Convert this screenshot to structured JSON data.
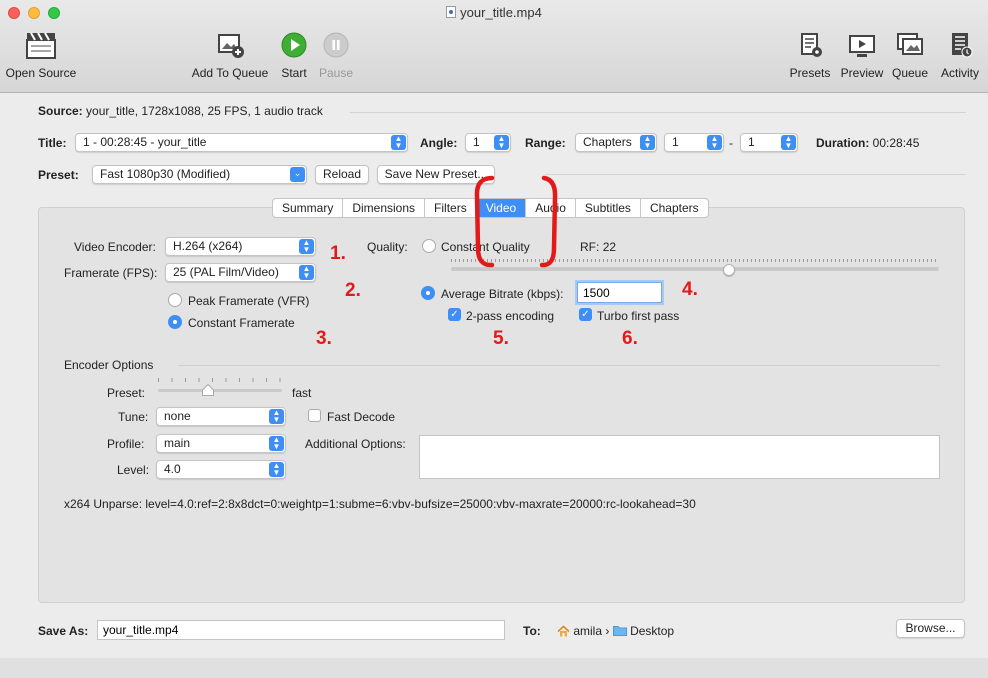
{
  "window": {
    "title": "your_title.mp4"
  },
  "toolbar": {
    "open_source": "Open Source",
    "add_to_queue": "Add To Queue",
    "start": "Start",
    "pause": "Pause",
    "presets": "Presets",
    "preview": "Preview",
    "queue": "Queue",
    "activity": "Activity"
  },
  "source": {
    "label": "Source:",
    "value": "your_title, 1728x1088, 25 FPS, 1 audio track"
  },
  "title_row": {
    "title_label": "Title:",
    "title_value": "1 - 00:28:45 - your_title",
    "angle_label": "Angle:",
    "angle_value": "1",
    "range_label": "Range:",
    "range_type": "Chapters",
    "range_start": "1",
    "range_dash": "-",
    "range_end": "1",
    "duration_label": "Duration:",
    "duration_value": "00:28:45"
  },
  "preset_row": {
    "label": "Preset:",
    "value": "Fast 1080p30 (Modified)",
    "reload": "Reload",
    "save_new": "Save New Preset..."
  },
  "tabs": [
    "Summary",
    "Dimensions",
    "Filters",
    "Video",
    "Audio",
    "Subtitles",
    "Chapters"
  ],
  "active_tab": "Video",
  "video": {
    "encoder_label": "Video Encoder:",
    "encoder_value": "H.264 (x264)",
    "framerate_label": "Framerate (FPS):",
    "framerate_value": "25 (PAL Film/Video)",
    "peak_framerate": "Peak Framerate (VFR)",
    "constant_framerate": "Constant Framerate",
    "quality_label": "Quality:",
    "constant_quality": "Constant Quality",
    "rf_label": "RF:",
    "rf_value": "22",
    "quality_slider_fraction": 0.57,
    "avg_bitrate_label": "Average Bitrate (kbps):",
    "avg_bitrate_value": "1500",
    "two_pass": "2-pass encoding",
    "turbo": "Turbo first pass"
  },
  "encoder_options": {
    "header": "Encoder Options",
    "preset_label": "Preset:",
    "preset_value": "fast",
    "preset_slider_fraction": 0.4,
    "tune_label": "Tune:",
    "tune_value": "none",
    "fast_decode": "Fast Decode",
    "profile_label": "Profile:",
    "profile_value": "main",
    "additional_label": "Additional Options:",
    "level_label": "Level:",
    "level_value": "4.0",
    "unparse": "x264 Unparse: level=4.0:ref=2:8x8dct=0:weightp=1:subme=6:vbv-bufsize=25000:vbv-maxrate=20000:rc-lookahead=30"
  },
  "annotations": {
    "n1": "1.",
    "n2": "2.",
    "n3": "3.",
    "n4": "4.",
    "n5": "5.",
    "n6": "6."
  },
  "save": {
    "label": "Save As:",
    "value": "your_title.mp4",
    "to_label": "To:",
    "user": "amila",
    "sep": "›",
    "folder": "Desktop",
    "browse": "Browse..."
  },
  "colors": {
    "accent": "#3f8ef6",
    "annotation": "#e31a1a"
  }
}
